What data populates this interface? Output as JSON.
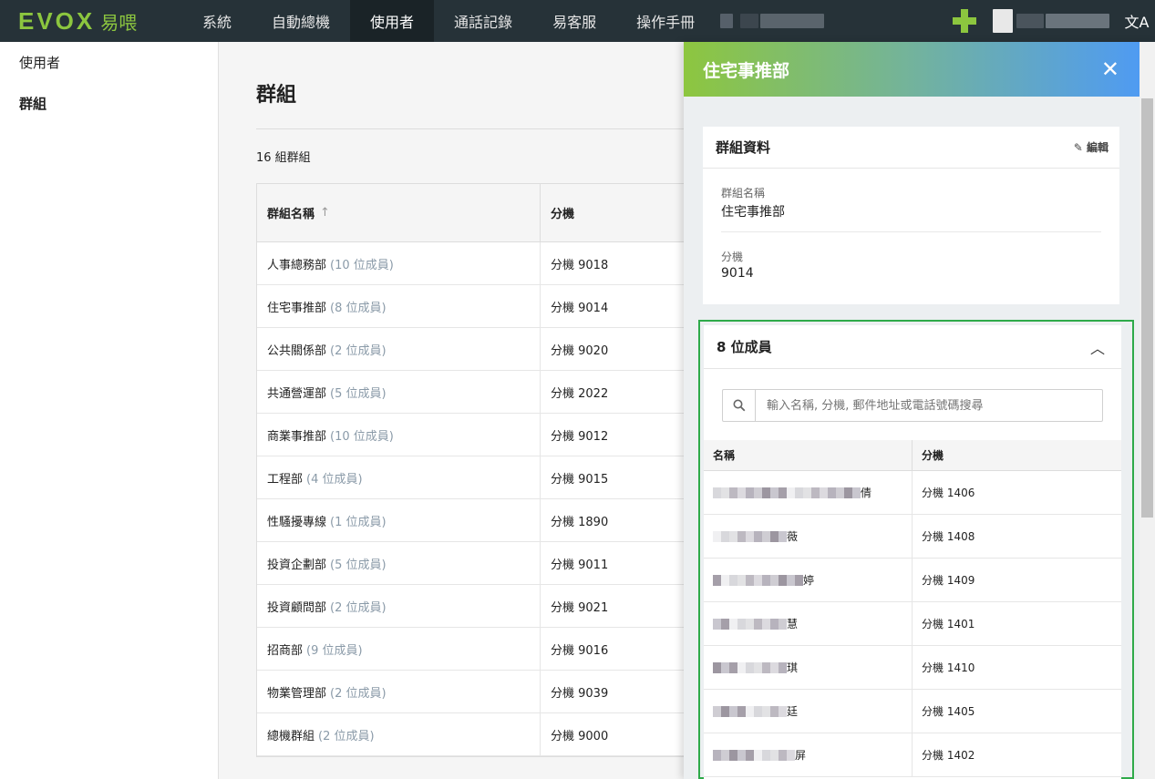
{
  "nav": {
    "logo_text": "EVOX",
    "logo_cn": "易喂",
    "items": [
      "系統",
      "自動總機",
      "使用者",
      "通話記錄",
      "易客服",
      "操作手冊"
    ],
    "active_index": 2,
    "lang_icon": "translate-icon"
  },
  "sidebar": {
    "items": [
      "使用者",
      "群組"
    ],
    "active_index": 1
  },
  "main": {
    "title": "群組",
    "count_text": "16 組群組",
    "columns": {
      "name": "群組名稱",
      "sort_icon": "↑",
      "ext": "分機"
    },
    "rows": [
      {
        "name": "人事總務部",
        "members": "(10 位成員)",
        "ext": "分機 9018"
      },
      {
        "name": "住宅事推部",
        "members": "(8 位成員)",
        "ext": "分機 9014"
      },
      {
        "name": "公共關係部",
        "members": "(2 位成員)",
        "ext": "分機 9020"
      },
      {
        "name": "共通營運部",
        "members": "(5 位成員)",
        "ext": "分機 2022"
      },
      {
        "name": "商業事推部",
        "members": "(10 位成員)",
        "ext": "分機 9012"
      },
      {
        "name": "工程部",
        "members": "(4 位成員)",
        "ext": "分機 9015"
      },
      {
        "name": "性騷擾專線",
        "members": "(1 位成員)",
        "ext": "分機 1890"
      },
      {
        "name": "投資企劃部",
        "members": "(5 位成員)",
        "ext": "分機 9011"
      },
      {
        "name": "投資顧問部",
        "members": "(2 位成員)",
        "ext": "分機 9021"
      },
      {
        "name": "招商部",
        "members": "(9 位成員)",
        "ext": "分機 9016"
      },
      {
        "name": "物業管理部",
        "members": "(2 位成員)",
        "ext": "分機 9039"
      },
      {
        "name": "總機群組",
        "members": "(2 位成員)",
        "ext": "分機 9000"
      }
    ]
  },
  "panel": {
    "title": "住宅事推部",
    "close_symbol": "✕",
    "info": {
      "title": "群組資料",
      "edit_label": "✎ 編輯",
      "name_label": "群組名稱",
      "name_value": "住宅事推部",
      "ext_label": "分機",
      "ext_value": "9014"
    },
    "members": {
      "title": "8 位成員",
      "chevron": "︿",
      "search_placeholder": "輸入名稱, 分機, 郵件地址或電話號碼搜尋",
      "col_name": "名稱",
      "col_ext": "分機",
      "rows": [
        {
          "name_end": "倩",
          "ext": "分機 1406"
        },
        {
          "name_end": "薇",
          "ext": "分機 1408"
        },
        {
          "name_end": "婷",
          "ext": "分機 1409"
        },
        {
          "name_end": "慧",
          "ext": "分機 1401"
        },
        {
          "name_end": "琪",
          "ext": "分機 1410"
        },
        {
          "name_end": "廷",
          "ext": "分機 1405"
        },
        {
          "name_end": "屏",
          "ext": "分機 1402"
        }
      ]
    }
  }
}
